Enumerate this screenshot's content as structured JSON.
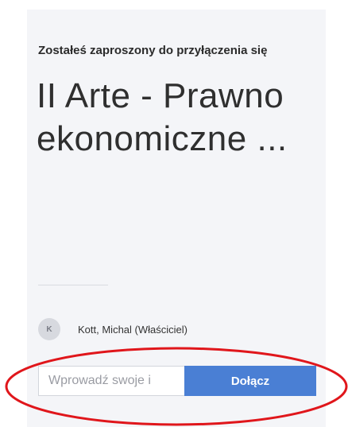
{
  "invite": {
    "label": "Zostałeś zaproszony do przyłączenia się",
    "team_name": "II Arte - Prawno ekonomiczne ..."
  },
  "owner": {
    "avatar_initial": "K",
    "name": "Kott, Michal (Właściciel)"
  },
  "join_form": {
    "input_placeholder": "Wprowadź swoje i",
    "button_label": "Dołącz"
  },
  "colors": {
    "card_background": "#f4f5f8",
    "button_blue": "#4a7fd4",
    "annotation_red": "#e0161b"
  }
}
